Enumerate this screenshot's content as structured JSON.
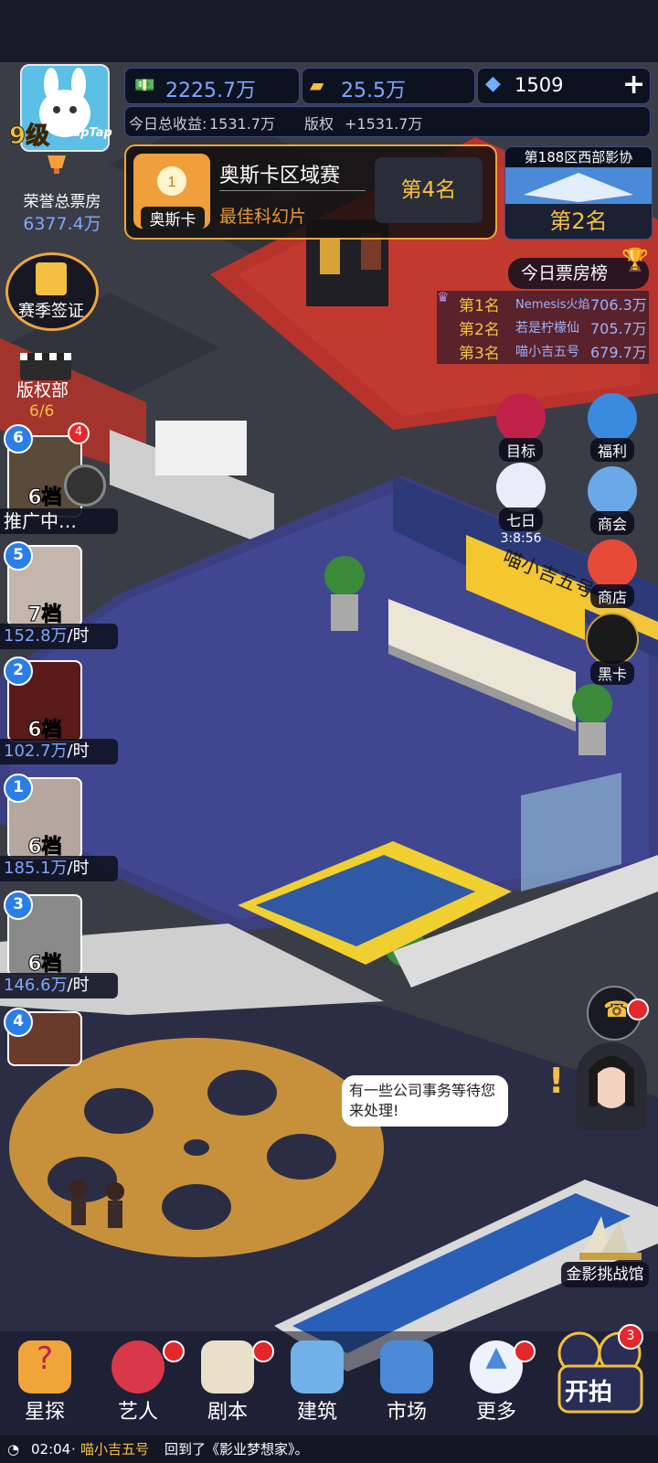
{
  "player": {
    "level": "9级",
    "tap_label": "TapTap"
  },
  "honor": {
    "label": "荣誉总票房",
    "value": "6377.4万"
  },
  "currencies": {
    "money": "2225.7万",
    "gold": "25.5万",
    "diamond": "1509",
    "add": "+"
  },
  "income": {
    "today_label": "今日总收益:",
    "today_value": "1531.7万",
    "rights_label": "版权",
    "rights_value": "+1531.7万"
  },
  "oscar": {
    "icon_label": "奥斯卡",
    "title": "奥斯卡区域赛",
    "subtitle": "最佳科幻片",
    "rank": "第4名"
  },
  "district": {
    "title": "第188区西部影协",
    "rank": "第2名"
  },
  "season": {
    "label": "赛季签证"
  },
  "rights_dept": {
    "label": "版权部",
    "count": "6/6"
  },
  "boxoffice": {
    "title": "今日票房榜",
    "rows": [
      {
        "rank": "第1名",
        "name": "Nemesis火焰",
        "value": "706.3万"
      },
      {
        "rank": "第2名",
        "name": "若是柠檬仙",
        "value": "705.7万"
      },
      {
        "rank": "第3名",
        "name": "喵小吉五号",
        "value": "679.7万"
      }
    ]
  },
  "films": [
    {
      "num": "6",
      "grade": "6档",
      "status": "推广中…",
      "notif": "4"
    },
    {
      "num": "5",
      "grade": "7档",
      "rate": "152.8万",
      "unit": "/时"
    },
    {
      "num": "2",
      "grade": "6档",
      "rate": "102.7万",
      "unit": "/时"
    },
    {
      "num": "1",
      "grade": "6档",
      "rate": "185.1万",
      "unit": "/时"
    },
    {
      "num": "3",
      "grade": "6档",
      "rate": "146.6万",
      "unit": "/时"
    },
    {
      "num": "4"
    }
  ],
  "right_buttons": {
    "goal": "目标",
    "welfare": "福利",
    "seven_day": "七日",
    "timer": "3:8:56",
    "guild": "商会",
    "shop": "商店",
    "black_card": "黑卡"
  },
  "signboard": "喵小吉五号",
  "speech": "有一些公司事务等待您来处理!",
  "challenge": "金影挑战馆",
  "nav": {
    "scout": "星探",
    "artist": "艺人",
    "script": "剧本",
    "build": "建筑",
    "market": "市场",
    "more": "更多",
    "shoot": "开拍",
    "shoot_badge": "3"
  },
  "ticker": {
    "time": "02:04",
    "sep": "·",
    "name": "喵小吉五号",
    "msg": "回到了《影业梦想家》。"
  },
  "colors": {
    "accent": "#f5c042",
    "blue_ui": "#2a7ee8",
    "floor": "#3b3f80",
    "red_carpet": "#b8332c"
  }
}
